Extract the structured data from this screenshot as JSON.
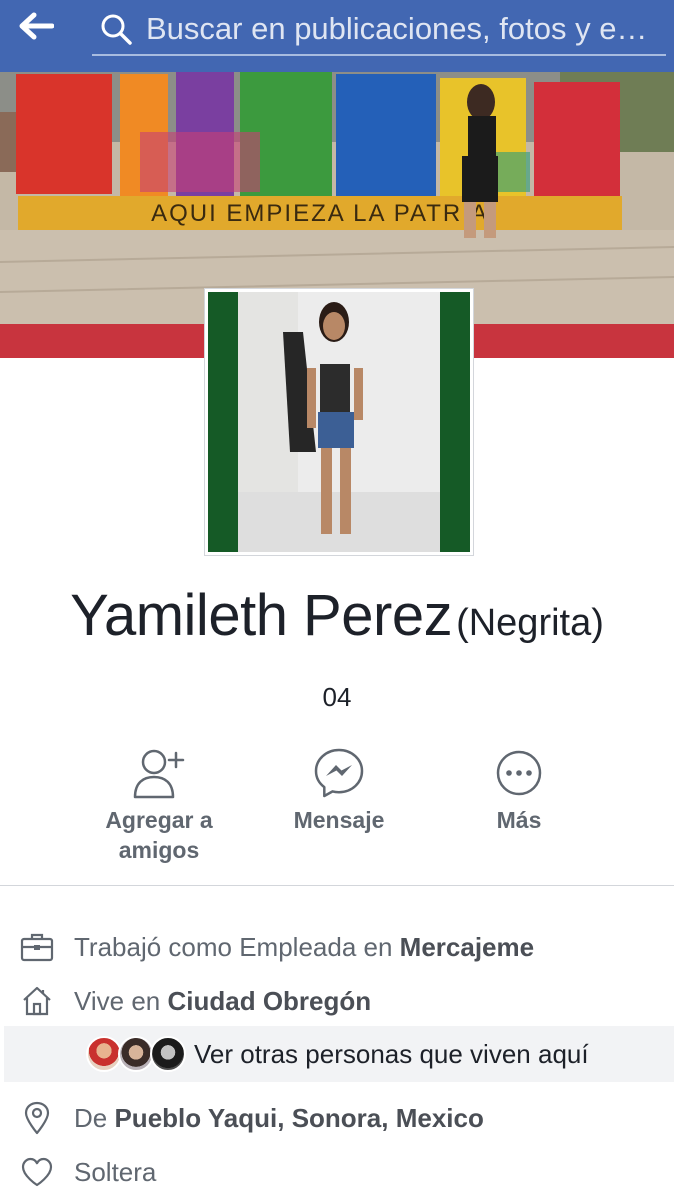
{
  "header": {
    "back_icon": "arrow-left-icon",
    "search_placeholder": "Buscar en publicaciones, fotos y e…",
    "bar_color": "#4267b2"
  },
  "cover": {
    "sign_line": "AQUI EMPIEZA LA PATRIA"
  },
  "profile": {
    "name": "Yamileth Perez",
    "alternate_name": "(Negrita)",
    "tagline": "04"
  },
  "actions": [
    {
      "label_line1": "Agregar a",
      "label_line2": "amigos",
      "icon": "add-friend-icon"
    },
    {
      "label_line1": "Mensaje",
      "label_line2": "",
      "icon": "messenger-icon"
    },
    {
      "label_line1": "Más",
      "label_line2": "",
      "icon": "more-icon"
    }
  ],
  "about": {
    "work_prefix": "Trabajó como Empleada en ",
    "work_place": "Mercajeme",
    "lives_prefix": "Vive en ",
    "lives_place": "Ciudad Obregón",
    "residents_link": "Ver otras personas que viven aquí",
    "from_prefix": "De ",
    "from_place": "Pueblo Yaqui, Sonora, Mexico",
    "relationship": "Soltera"
  }
}
